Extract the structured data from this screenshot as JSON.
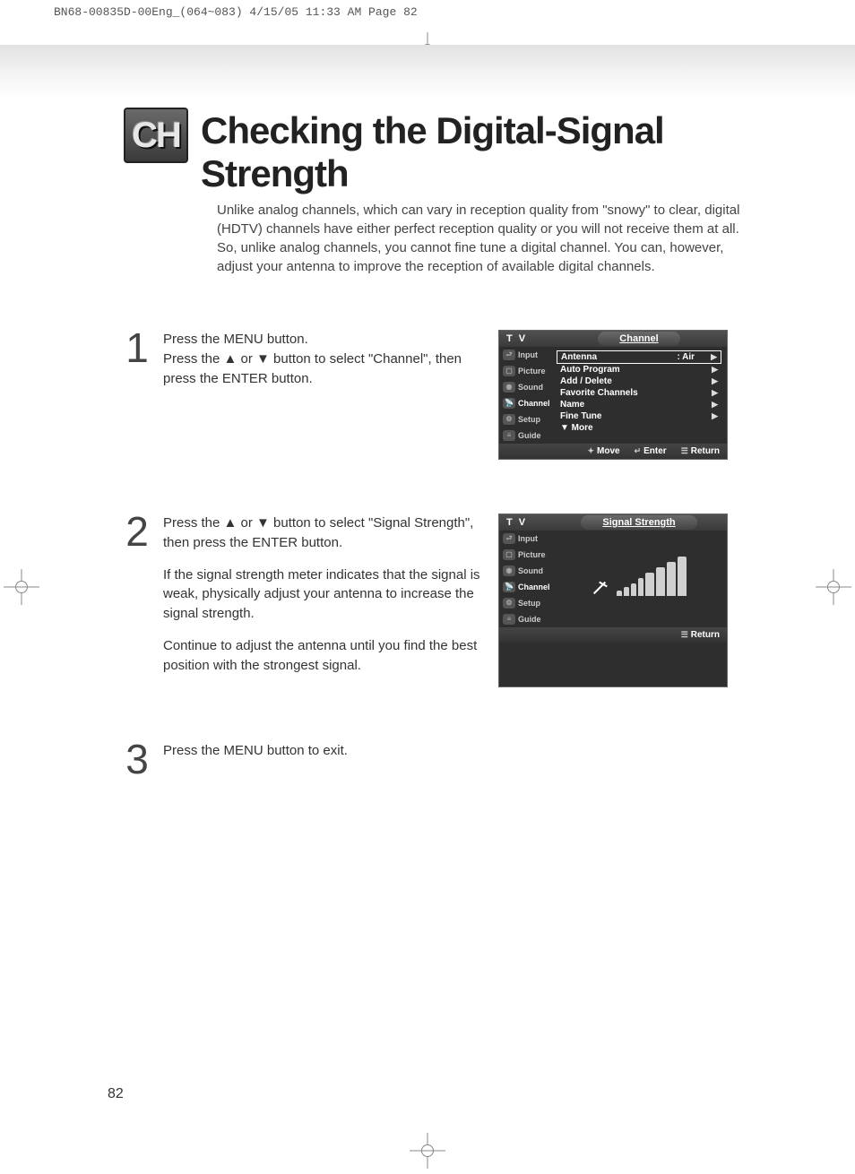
{
  "header_text": "BN68-00835D-00Eng_(064~083)  4/15/05  11:33 AM  Page 82",
  "badge": "CH",
  "title": "Checking the Digital-Signal Strength",
  "intro": "Unlike analog channels, which can vary in reception quality from \"snowy\" to clear, digital (HDTV) channels have either perfect reception quality or you will not receive them at all. So, unlike analog channels, you cannot fine tune a digital channel. You can, however, adjust your antenna to improve the reception of available digital channels.",
  "steps": {
    "s1": {
      "num": "1",
      "p1": "Press the MENU button.",
      "p2": "Press the ▲ or ▼ button to select \"Channel\", then press the ENTER button."
    },
    "s2": {
      "num": "2",
      "p1": "Press the ▲ or ▼ button to select \"Signal Strength\", then press the ENTER button.",
      "p2": "If the signal strength meter indicates that the signal is weak, physically adjust your antenna to increase the signal strength.",
      "p3": "Continue to adjust the antenna until you find the best position with the strongest signal."
    },
    "s3": {
      "num": "3",
      "p1": "Press the MENU button to exit."
    }
  },
  "menu1": {
    "tv": "T V",
    "title": "Channel",
    "side": {
      "input": "Input",
      "picture": "Picture",
      "sound": "Sound",
      "channel": "Channel",
      "setup": "Setup",
      "guide": "Guide"
    },
    "rows": {
      "antenna": "Antenna",
      "antenna_val": ": Air",
      "auto": "Auto Program",
      "add": "Add / Delete",
      "fav": "Favorite Channels",
      "name": "Name",
      "fine": "Fine Tune",
      "more": "▼ More"
    },
    "footer": {
      "move": "Move",
      "enter": "Enter",
      "return": "Return"
    }
  },
  "menu2": {
    "tv": "T V",
    "title": "Signal Strength",
    "side": {
      "input": "Input",
      "picture": "Picture",
      "sound": "Sound",
      "channel": "Channel",
      "setup": "Setup",
      "guide": "Guide"
    },
    "footer": {
      "return": "Return"
    }
  },
  "page_num": "82"
}
